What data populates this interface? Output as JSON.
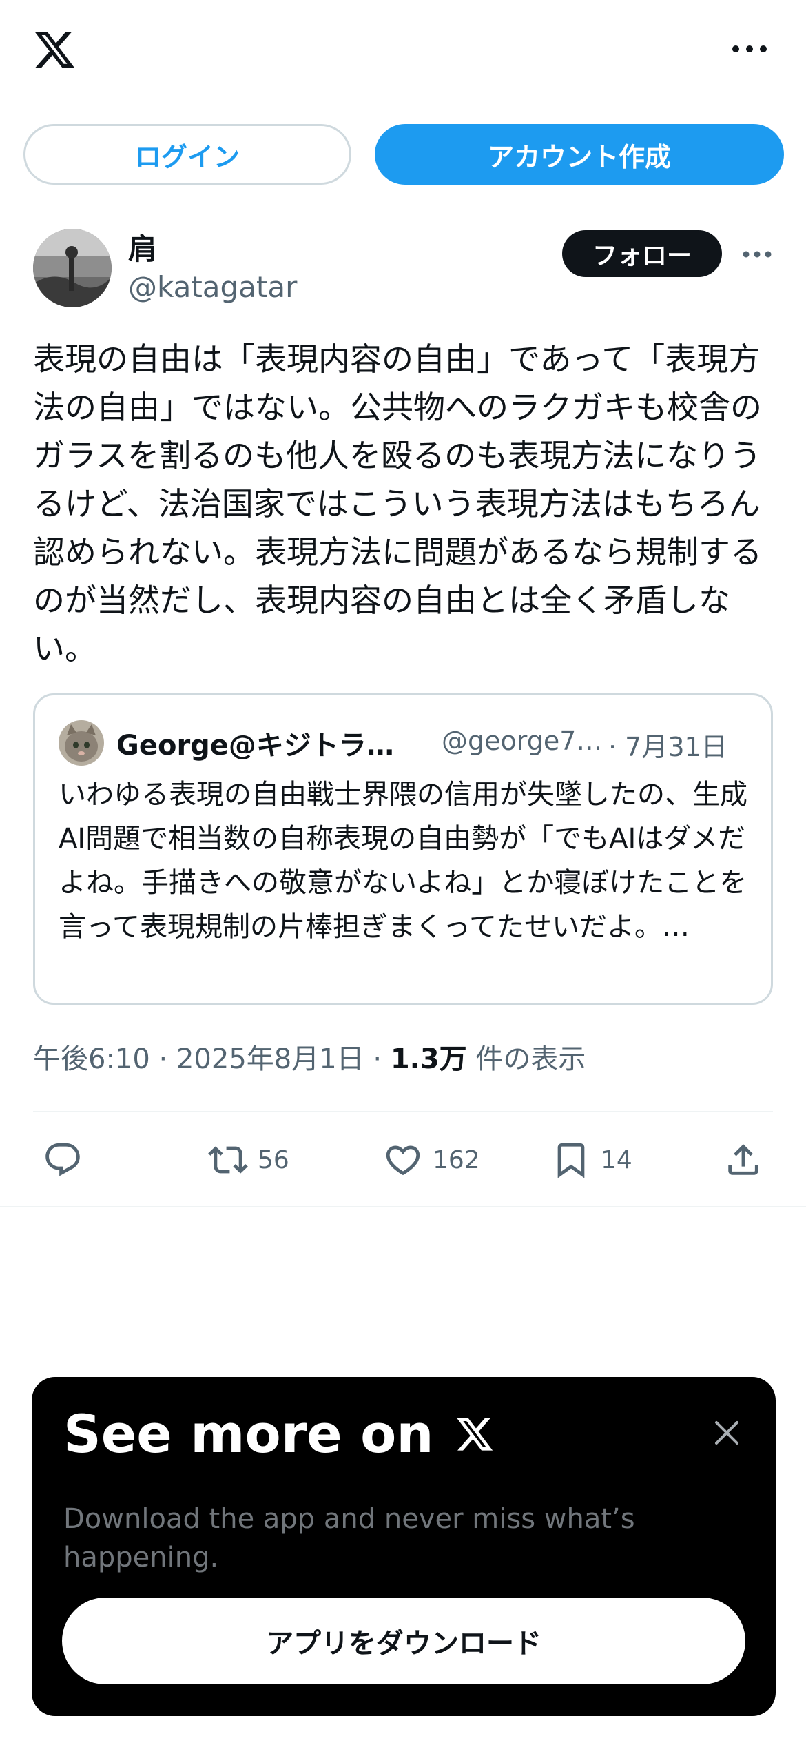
{
  "header": {
    "logo_icon": "x-logo-icon",
    "more_icon": "more-horizontal-icon"
  },
  "auth": {
    "login_label": "ログイン",
    "signup_label": "アカウント作成"
  },
  "post": {
    "display_name": "肩",
    "handle": "@katagatar",
    "follow_label": "フォロー",
    "text": "表現の自由は「表現内容の自由」であって「表現方法の自由」ではない。公共物へのラクガキも校舎のガラスを割るのも他人を殴るのも表現方法になりうるけど、法治国家ではこういう表現方法はもちろん認められない。表現方法に問題があるなら規制するのが当然だし、表現内容の自由とは全く矛盾しない。",
    "timestamp": "午後6:10 · 2025年8月1日 · ",
    "views_count": "1.3万",
    "views_label": " 件の表示",
    "stats": {
      "replies": "",
      "reposts": "56",
      "likes": "162",
      "bookmarks": "14"
    }
  },
  "quote": {
    "display_name": "George@キジトラ…",
    "handle": "@george7…",
    "date": " · 7月31日",
    "text": "いわゆる表現の自由戦士界隈の信用が失墜したの、生成AI問題で相当数の自称表現の自由勢が「でもAIはダメだよね。手描きへの敬意がないよね」とか寝ぼけたことを言って表現規制の片棒担ぎまくってたせいだよ。…"
  },
  "promo": {
    "title": "See more on",
    "subtitle": "Download the app and never miss what’s happening.",
    "button_label": "アプリをダウンロード"
  },
  "colors": {
    "accent": "#1d9bf0",
    "text_primary": "#0f1419",
    "text_secondary": "#536471",
    "border": "#cfd9de"
  }
}
